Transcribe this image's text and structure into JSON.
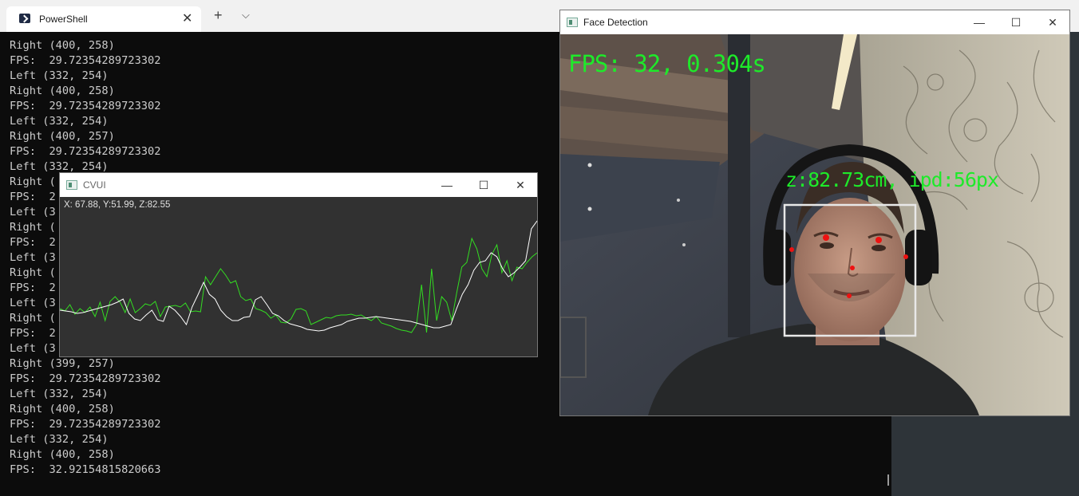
{
  "desktop": {
    "accent": "#2e3439"
  },
  "powershell": {
    "tab_title": "PowerShell",
    "tab_close": "✕",
    "new_tab": "+",
    "dropdown": "⌵",
    "lines": [
      "Right (400, 258)",
      "FPS:  29.72354289723302",
      "Left (332, 254)",
      "Right (400, 258)",
      "FPS:  29.72354289723302",
      "Left (332, 254)",
      "Right (400, 257)",
      "FPS:  29.72354289723302",
      "Left (332, 254)",
      "Right (",
      "FPS:  2",
      "Left (3",
      "Right (",
      "FPS:  2",
      "Left (3",
      "Right (",
      "FPS:  2",
      "Left (3",
      "Right (",
      "FPS:  2",
      "Left (3",
      "Right (399, 257)",
      "FPS:  29.72354289723302",
      "Left (332, 254)",
      "Right (400, 258)",
      "FPS:  29.72354289723302",
      "Left (332, 254)",
      "Right (400, 258)",
      "FPS:  32.92154815820663"
    ]
  },
  "cvui": {
    "title": "CVUI",
    "readout": "X: 67.88, Y:51.99, Z:82.55",
    "minimize": "—",
    "maximize": "☐",
    "close": "✕"
  },
  "chart_data": {
    "type": "line",
    "series": [
      {
        "color": "#33dd22",
        "values": [
          60,
          57,
          65,
          53,
          60,
          55,
          62,
          50,
          68,
          45,
          69,
          75,
          68,
          55,
          72,
          55,
          60,
          66,
          64,
          69,
          50,
          62,
          63,
          64,
          62,
          67,
          56,
          57,
          56,
          100,
          90,
          100,
          110,
          102,
          92,
          95,
          75,
          70,
          72,
          60,
          58,
          55,
          48,
          52,
          43,
          42,
          47,
          59,
          60,
          57,
          40,
          43,
          46,
          49,
          48,
          51,
          52,
          52,
          53,
          51,
          52,
          48,
          45,
          50,
          42,
          40,
          38,
          35,
          33,
          32,
          30,
          40,
          90,
          30,
          110,
          45,
          75,
          68,
          45,
          80,
          112,
          118,
          148,
          135,
          110,
          100,
          128,
          140,
          105,
          120,
          95,
          112,
          110,
          118,
          125,
          130
        ]
      },
      {
        "color": "#ffffff",
        "values": [
          58,
          57,
          56,
          54,
          55,
          57,
          59,
          61,
          63,
          65,
          68,
          72,
          54,
          47,
          45,
          52,
          58,
          46,
          44,
          63,
          58,
          50,
          40,
          62,
          77,
          93,
          78,
          72,
          58,
          50,
          45,
          45,
          49,
          50,
          71,
          75,
          65,
          54,
          51,
          45,
          41,
          39,
          37,
          34,
          33,
          32,
          33,
          36,
          38,
          40,
          44,
          46,
          48,
          48,
          49,
          50,
          49,
          48,
          47,
          46,
          45,
          44,
          42,
          40,
          38,
          36,
          36,
          38,
          40,
          60,
          78,
          90,
          108,
          118,
          120,
          130,
          125,
          110,
          100,
          105,
          112,
          120,
          160,
          170
        ]
      }
    ],
    "xlim": [
      0,
      96
    ],
    "ylim": [
      0,
      200
    ],
    "grid": false
  },
  "face": {
    "title": "Face Detection",
    "fps_text": "FPS: 32, 0.304s",
    "z_text": "z:82.73cm, ipd:56px",
    "overlay_color": "#1eea2a",
    "minimize": "—",
    "maximize": "☐",
    "close": "✕"
  }
}
